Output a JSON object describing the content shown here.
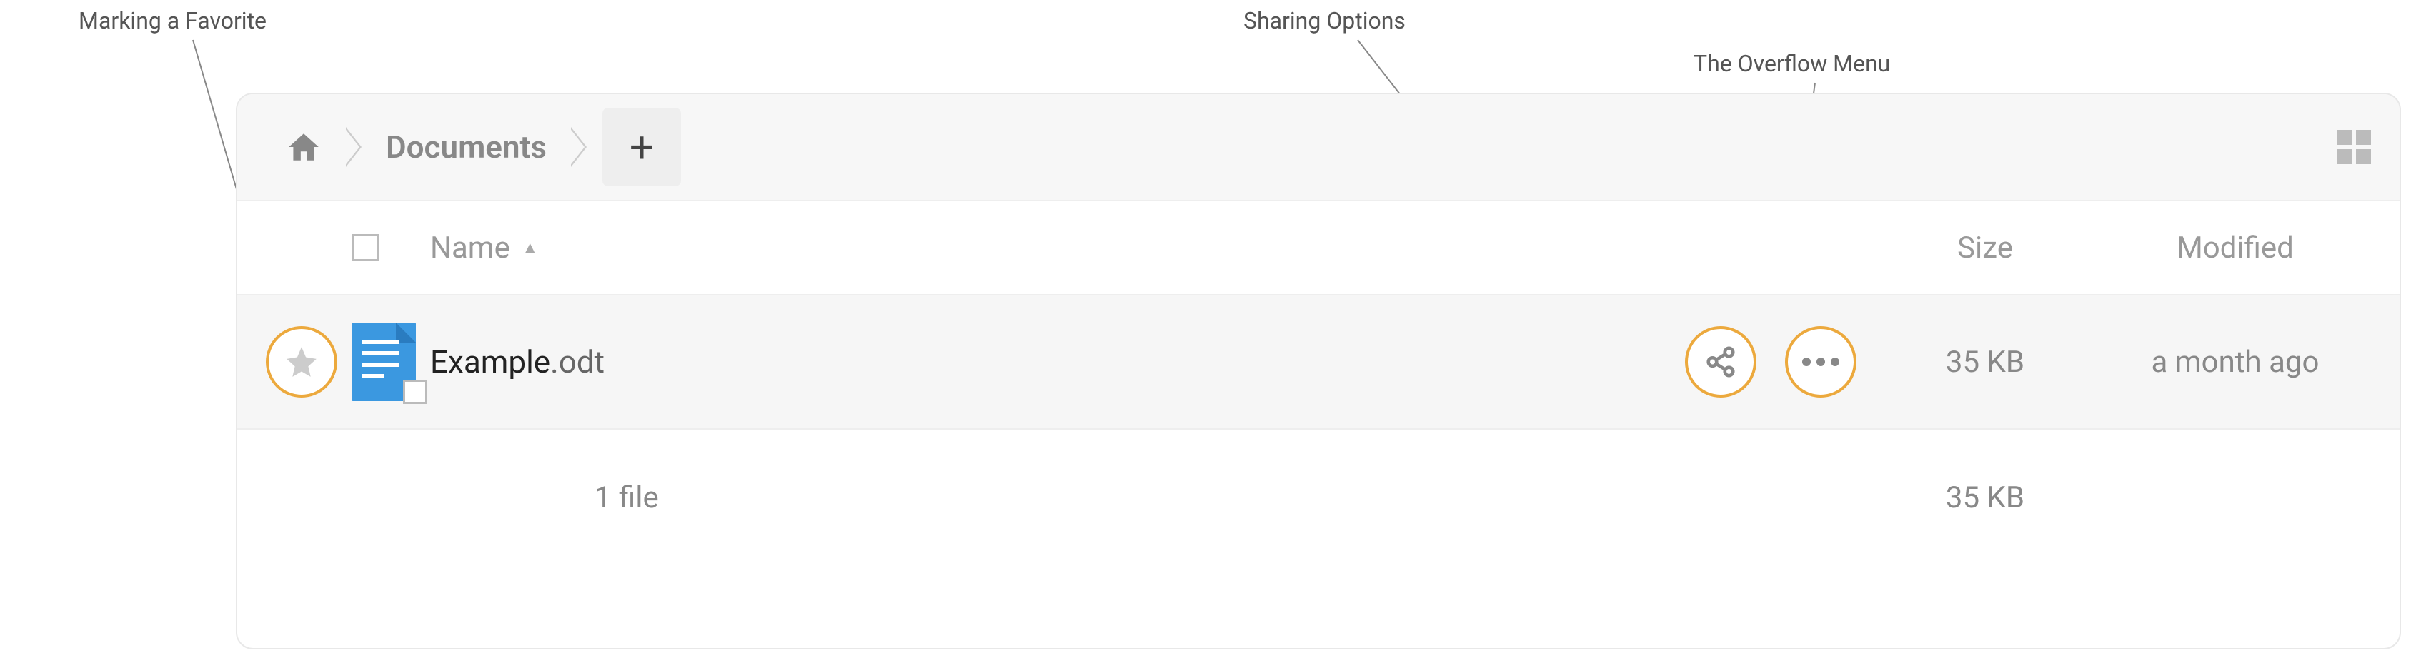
{
  "annotations": {
    "favorite": "Marking a Favorite",
    "sharing": "Sharing Options",
    "overflow": "The Overflow Menu"
  },
  "breadcrumb": {
    "current": "Documents",
    "add_label": "+"
  },
  "headers": {
    "name": "Name",
    "size": "Size",
    "modified": "Modified"
  },
  "file": {
    "basename": "Example",
    "ext": ".odt",
    "size": "35 KB",
    "modified": "a month ago"
  },
  "summary": {
    "count": "1 file",
    "total_size": "35 KB"
  }
}
